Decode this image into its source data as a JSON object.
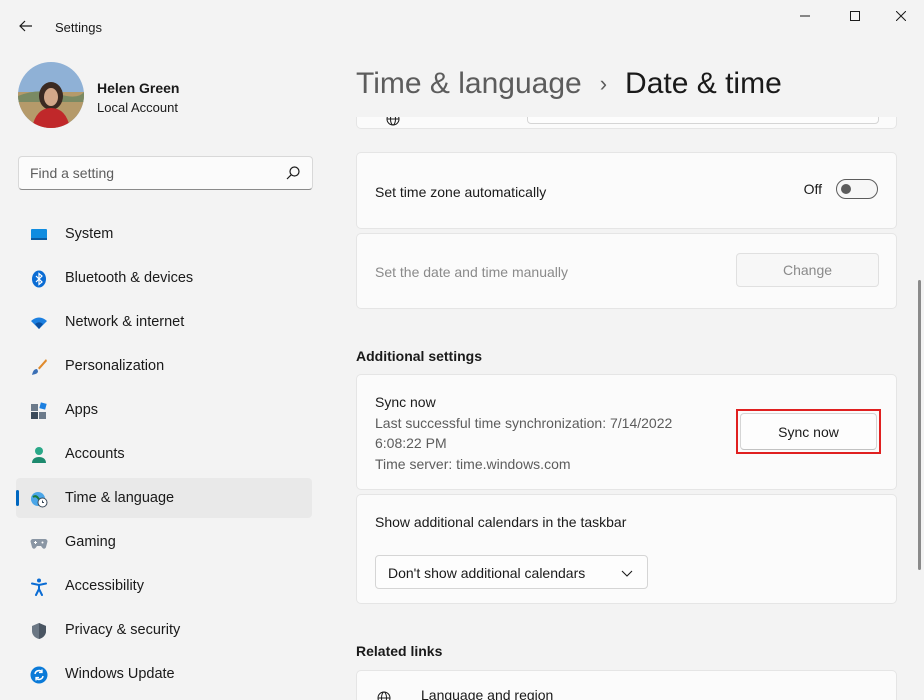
{
  "window": {
    "title": "Settings"
  },
  "profile": {
    "name": "Helen Green",
    "account_type": "Local Account"
  },
  "search": {
    "placeholder": "Find a setting"
  },
  "nav": {
    "items": [
      {
        "label": "System",
        "icon": "system-icon"
      },
      {
        "label": "Bluetooth & devices",
        "icon": "bluetooth-icon"
      },
      {
        "label": "Network & internet",
        "icon": "wifi-icon"
      },
      {
        "label": "Personalization",
        "icon": "brush-icon"
      },
      {
        "label": "Apps",
        "icon": "apps-icon"
      },
      {
        "label": "Accounts",
        "icon": "person-icon"
      },
      {
        "label": "Time & language",
        "icon": "globe-clock-icon",
        "active": true
      },
      {
        "label": "Gaming",
        "icon": "gamepad-icon"
      },
      {
        "label": "Accessibility",
        "icon": "accessibility-icon"
      },
      {
        "label": "Privacy & security",
        "icon": "shield-icon"
      },
      {
        "label": "Windows Update",
        "icon": "update-icon"
      }
    ]
  },
  "breadcrumb": {
    "parent": "Time & language",
    "separator": "›",
    "current": "Date & time"
  },
  "settings": {
    "time_zone_auto": {
      "label": "Set time zone automatically",
      "state_label": "Off"
    },
    "set_manually": {
      "label": "Set the date and time manually",
      "button_label": "Change"
    },
    "additional_title": "Additional settings",
    "sync": {
      "title": "Sync now",
      "last_sync_line1": "Last successful time synchronization: 7/14/2022",
      "last_sync_line2": "6:08:22 PM",
      "time_server": "Time server: time.windows.com",
      "button_label": "Sync now"
    },
    "calendars": {
      "label": "Show additional calendars in the taskbar",
      "selected": "Don't show additional calendars"
    },
    "related_title": "Related links",
    "related_first": "Language and region"
  },
  "colors": {
    "accent": "#0067c0",
    "highlight_box": "#e02020"
  }
}
